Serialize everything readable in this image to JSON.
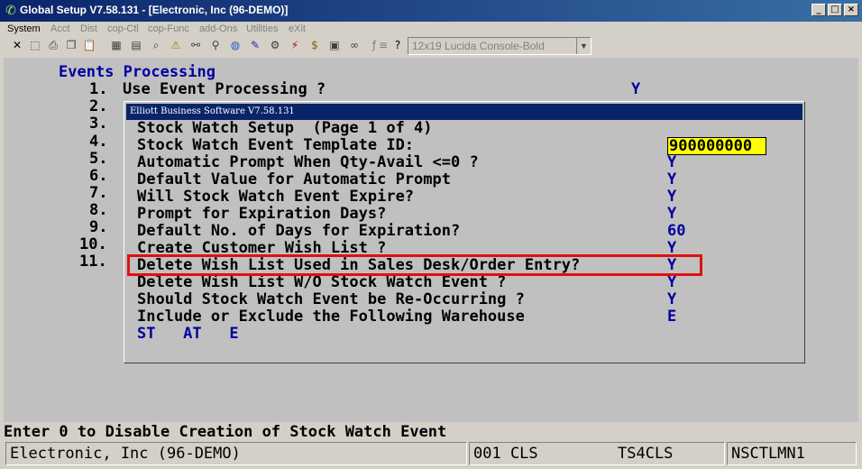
{
  "window": {
    "title": "Global Setup V7.58.131 - [Electronic, Inc (96-DEMO)]",
    "controls": [
      "_",
      "□",
      "×"
    ]
  },
  "menu": [
    {
      "label": "System",
      "enabled": true
    },
    {
      "label": "Acct",
      "enabled": false
    },
    {
      "label": "Dist",
      "enabled": false
    },
    {
      "label": "cop-Ctl",
      "enabled": false
    },
    {
      "label": "cop-Func",
      "enabled": false
    },
    {
      "label": "add-Ons",
      "enabled": false
    },
    {
      "label": "Utilities",
      "enabled": false
    },
    {
      "label": "eXit",
      "enabled": false
    }
  ],
  "toolbar": {
    "icons": [
      "close-icon",
      "select-icon",
      "print-icon",
      "copy-icon",
      "paste-icon",
      "calculator-icon",
      "notepad-icon",
      "lookup-icon",
      "warning-icon",
      "binoculars-icon",
      "zoom-icon",
      "globe-icon",
      "edit-icon",
      "settings-icon",
      "lightning-icon",
      "money-icon",
      "certificate-icon",
      "link-icon",
      "function-icon",
      "list-icon",
      "help-pointer-icon"
    ],
    "font_selector": "12x19 Lucida Console-Bold"
  },
  "screen": {
    "heading": "Events Processing",
    "numbers": [
      "1.",
      "2.",
      "3.",
      "4.",
      "5.",
      "6.",
      "7.",
      "8.",
      "9.",
      "10.",
      "11."
    ],
    "item1_label": "Use Event Processing ?",
    "item1_value": "Y"
  },
  "dialog": {
    "title": "Elliott Business Software V7.58.131",
    "header": "Stock Watch Setup  (Page 1 of 4)",
    "rows": [
      {
        "label": "Stock Watch Event Template ID:",
        "value": "900000000"
      },
      {
        "label": "Automatic Prompt When Qty-Avail <=0 ?",
        "value": "Y"
      },
      {
        "label": "Default Value for Automatic Prompt",
        "value": "Y"
      },
      {
        "label": "Will Stock Watch Event Expire?",
        "value": "Y"
      },
      {
        "label": "Prompt for Expiration Days?",
        "value": "Y"
      },
      {
        "label": "Default No. of Days for Expiration?",
        "value": "60"
      },
      {
        "label": "Create Customer Wish List ?",
        "value": "Y"
      },
      {
        "label": "Delete Wish List Used in Sales Desk/Order Entry?",
        "value": "Y"
      },
      {
        "label": "Delete Wish List W/O Stock Watch Event ?",
        "value": "Y"
      },
      {
        "label": "Should Stock Watch Event be Re-Occurring ?",
        "value": "Y"
      },
      {
        "label": "Include or Exclude the Following Warehouse",
        "value": "E"
      }
    ],
    "warehouses": "ST   AT   E"
  },
  "prompt": "Enter 0 to Disable Creation of Stock Watch Event",
  "status": {
    "company": "Electronic, Inc (96-DEMO)",
    "session": "001 CLS",
    "terminal": "TS4CLS",
    "program": "NSCTLMN1"
  },
  "colors": {
    "title_bar": "#0a246a",
    "field_highlight": "#ffff00",
    "annotation_box": "#e01010",
    "value_text": "#0000a0"
  }
}
